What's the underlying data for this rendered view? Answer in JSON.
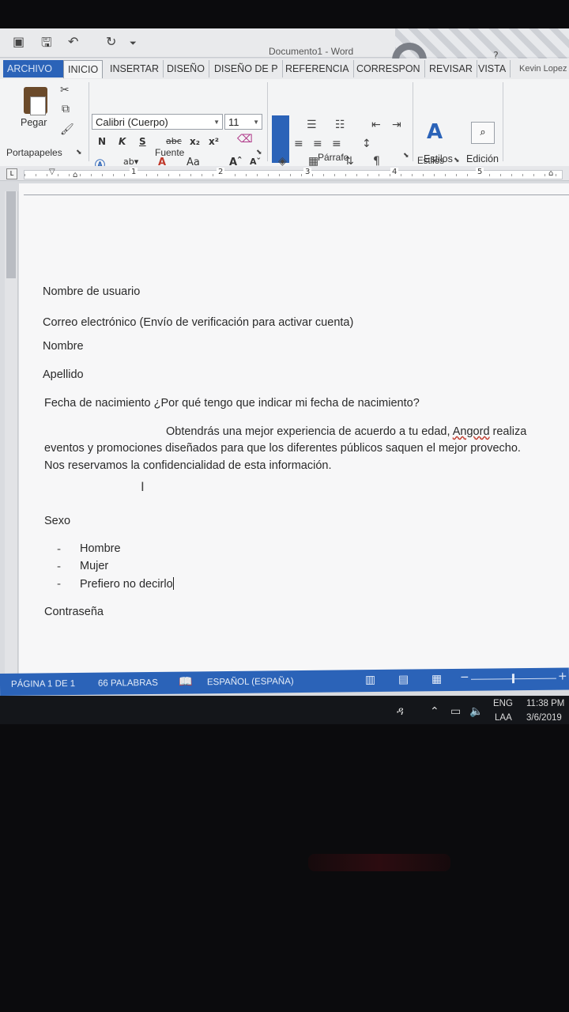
{
  "app": {
    "title": "Documento1 - Word",
    "help": "?"
  },
  "tabs": [
    {
      "label": "ARCHIVO"
    },
    {
      "label": "INICIO"
    },
    {
      "label": "INSERTAR"
    },
    {
      "label": "DISEÑO"
    },
    {
      "label": "DISEÑO DE P"
    },
    {
      "label": "REFERENCIA"
    },
    {
      "label": "CORRESPON"
    },
    {
      "label": "REVISAR"
    },
    {
      "label": "VISTA"
    }
  ],
  "user": "Kevin Lopez",
  "ribbon": {
    "paste_label": "Pegar",
    "font_name": "Calibri (Cuerpo)",
    "font_size": "11",
    "bold": "N",
    "italic": "K",
    "underline": "S",
    "strike": "abc",
    "subscript": "x₂",
    "superscript": "x²",
    "change_case": "Aa",
    "styles_label": "Estilos",
    "editing_label": "Edición",
    "groups": {
      "clipboard": "Portapapeles",
      "font": "Fuente",
      "paragraph": "Párrafo",
      "styles": "Estilos"
    }
  },
  "ruler": {
    "tab_selector": "L",
    "numbers": [
      "1",
      "2",
      "3",
      "4",
      "5"
    ]
  },
  "document": {
    "lines": [
      "Nombre de usuario",
      "Correo electrónico (Envío de verificación para activar cuenta)",
      "Nombre",
      "Apellido",
      "Fecha de nacimiento ¿Por qué tengo que indicar mi fecha de nacimiento?"
    ],
    "note_line1_a": "Obtendrás una mejor experiencia de acuerdo a tu edad, ",
    "note_line1_brand": "Angord",
    "note_line1_b": " realiza",
    "note_line2": "eventos y promociones diseñados para que los diferentes públicos saquen el mejor provecho.",
    "note_line3": "Nos reservamos la confidencialidad de esta información.",
    "sexo_label": "Sexo",
    "sexo_options": [
      "Hombre",
      "Mujer",
      "Prefiero no decirlo"
    ],
    "password_label": "Contraseña"
  },
  "status": {
    "page": "PÁGINA 1 DE 1",
    "words": "66 PALABRAS",
    "language": "ESPAÑOL (ESPAÑA)"
  },
  "taskbar": {
    "lang_top": "ENG",
    "lang_bottom": "LAA",
    "time": "11:38 PM",
    "date": "3/6/2019"
  },
  "colors": {
    "accent": "#2b63b8",
    "taskbar": "#14161a"
  }
}
